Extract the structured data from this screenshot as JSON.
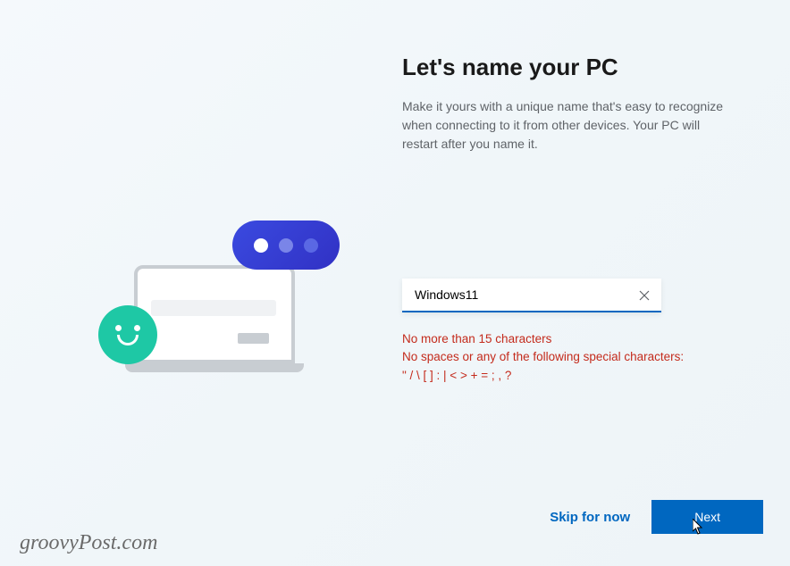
{
  "title": "Let's name your PC",
  "subtitle": "Make it yours with a unique name that's easy to recognize when connecting to it from other devices. Your PC will restart after you name it.",
  "input": {
    "value": "Windows11",
    "placeholder": ""
  },
  "validation": {
    "line1": "No more than 15 characters",
    "line2": "No spaces or any of the following special characters:",
    "line3": "\" / \\ [ ] : | < > + = ; , ?"
  },
  "footer": {
    "skip": "Skip for now",
    "next": "Next"
  },
  "watermark": "groovyPost.com",
  "colors": {
    "accent": "#0067c0",
    "error": "#c42b1c",
    "smiley": "#1ec8a5",
    "bubble": "#3131c4"
  }
}
